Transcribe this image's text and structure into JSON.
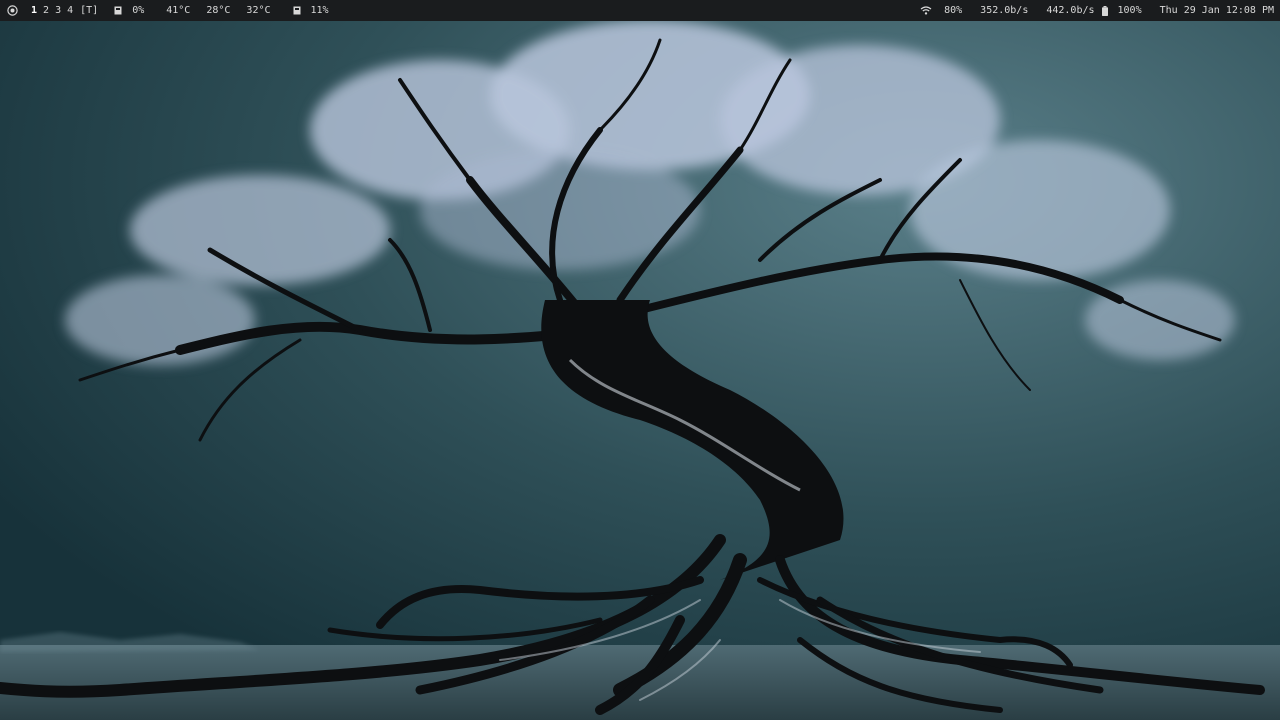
{
  "wallpaper": {
    "subject": "bare winter tree with tangled roots",
    "colors": {
      "sky_top": "#5a7f89",
      "sky_mid": "#2f5058",
      "sky_dark": "#17323a",
      "water": "#4f6a73",
      "canopy": "#b9c6dc",
      "trunk": "#0d0f11"
    }
  },
  "statusbar": {
    "background": "#1a1c1e",
    "text_color": "#d8d8d8",
    "workspaces": [
      "1",
      "2",
      "3",
      "4"
    ],
    "active_workspace": "1",
    "layout": "[T]",
    "cpu": "0%",
    "temp1": "41°C",
    "temp2": "28°C",
    "temp3": "32°C",
    "memory": "11%",
    "wifi_strength": "80%",
    "net_down": "352.0b/s",
    "net_up": "442.0b/s",
    "battery": "100%",
    "datetime": "Thu 29 Jan 12:08 PM",
    "icons": {
      "launcher": "launcher-icon",
      "cpu": "chip-icon",
      "memory": "memory-icon",
      "wifi": "wifi-icon",
      "battery": "battery-icon"
    }
  }
}
